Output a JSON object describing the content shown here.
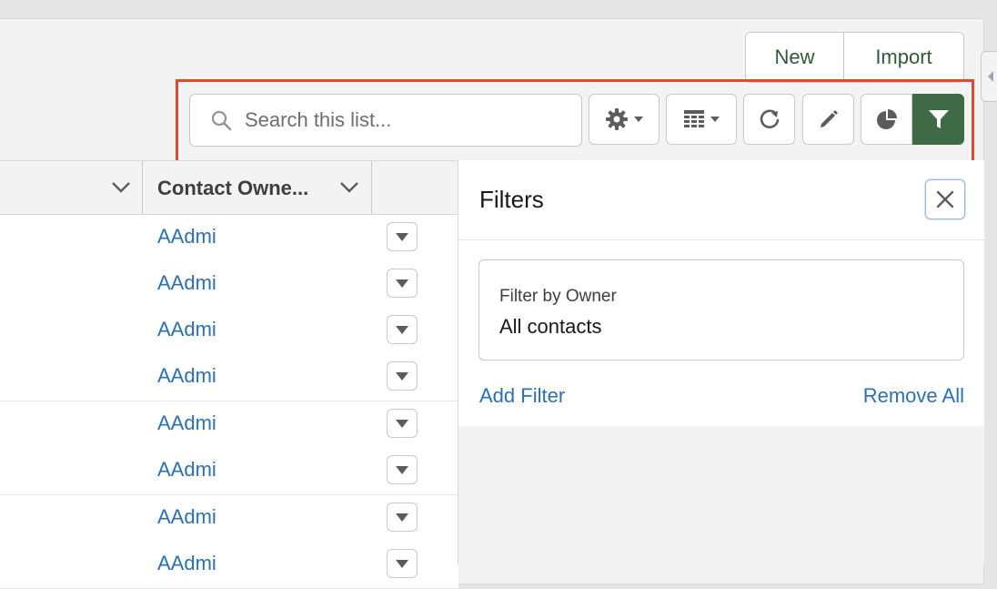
{
  "header": {
    "new_label": "New",
    "import_label": "Import"
  },
  "toolbar": {
    "search_placeholder": "Search this list...",
    "icons": [
      "search-icon",
      "gear-icon",
      "table-icon",
      "refresh-icon",
      "pencil-icon",
      "pie-chart-icon",
      "filter-icon"
    ]
  },
  "table": {
    "columns": [
      {
        "label": ""
      },
      {
        "label": "Contact Owne..."
      }
    ],
    "rows": [
      {
        "owner": "AAdmi"
      },
      {
        "owner": "AAdmi"
      },
      {
        "owner": "AAdmi"
      },
      {
        "owner": "AAdmi"
      },
      {
        "owner": "AAdmi"
      },
      {
        "owner": "AAdmi"
      },
      {
        "owner": "AAdmi"
      },
      {
        "owner": "AAdmi"
      }
    ]
  },
  "filters": {
    "title": "Filters",
    "card_label": "Filter by Owner",
    "card_value": "All contacts",
    "add_filter": "Add Filter",
    "remove_all": "Remove All"
  },
  "colors": {
    "brand_green": "#3f6a46",
    "link_blue": "#2870b8",
    "highlight_red": "#e14a2f"
  }
}
